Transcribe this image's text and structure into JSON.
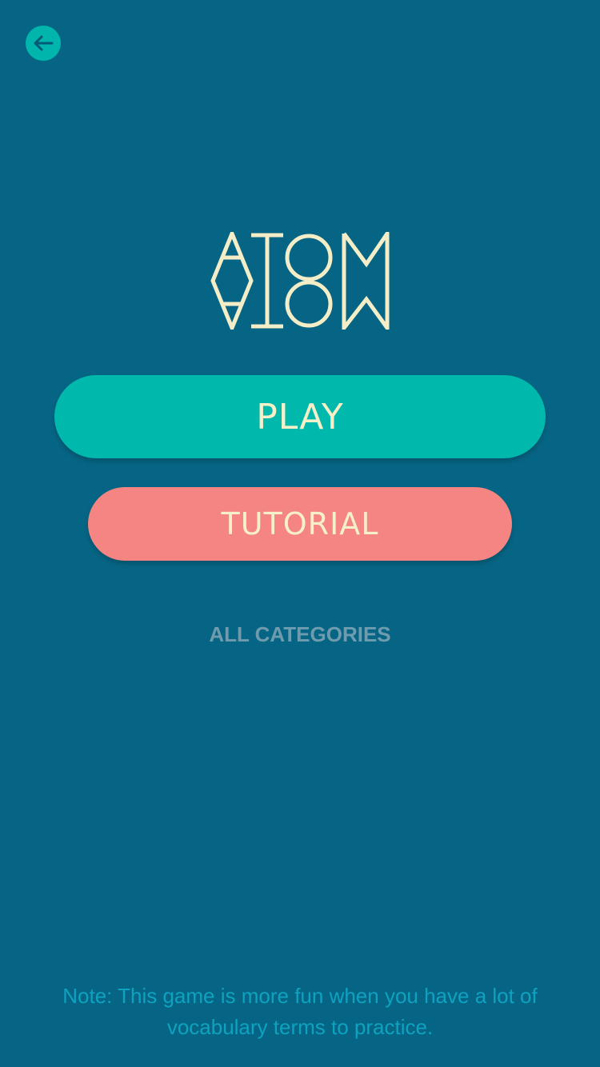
{
  "colors": {
    "background": "#066584",
    "accent_teal": "#00b8ac",
    "accent_coral": "#f48582",
    "cream": "#f6f0c9",
    "muted_link": "#6e9cae",
    "note_text": "#0ea2c0"
  },
  "header": {
    "back_icon": "arrow-left-icon"
  },
  "logo": {
    "text": "ATOM"
  },
  "menu": {
    "play_label": "PLAY",
    "tutorial_label": "TUTORIAL",
    "categories_label": "ALL CATEGORIES"
  },
  "footer": {
    "note": "Note: This game is more fun when you have a lot of vocabulary terms to practice."
  }
}
